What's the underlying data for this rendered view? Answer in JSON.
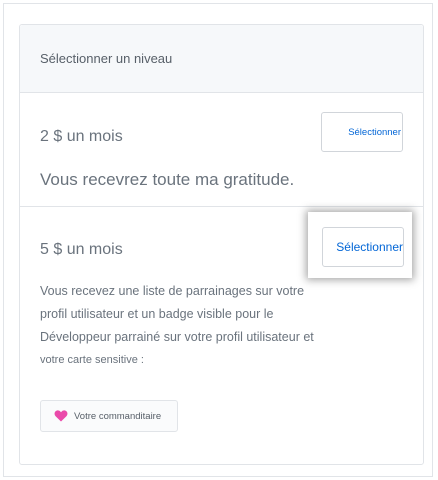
{
  "header": {
    "title": "Sélectionner un niveau"
  },
  "tiers": [
    {
      "price": "2 $ un mois",
      "description": "Vous recevrez toute ma gratitude.",
      "button_label": "Sélectionner"
    },
    {
      "price": "5 $ un mois",
      "description_lines": [
        "Vous recevez une liste de parrainages sur votre",
        "profil utilisateur et un badge visible pour le",
        "Développeur parrainé sur votre profil utilisateur et",
        "votre carte sensitive :"
      ],
      "button_label": "Sélectionner",
      "badge_label": "Votre commanditaire",
      "badge_icon": "heart-icon",
      "badge_icon_color": "#ea4aaa"
    }
  ],
  "colors": {
    "link": "#0366d6",
    "border": "#e1e4e8",
    "header_bg": "#f6f8fa"
  }
}
